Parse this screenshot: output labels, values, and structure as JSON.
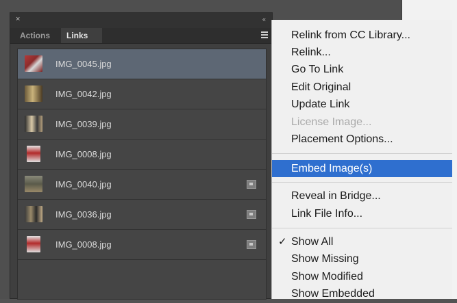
{
  "panel": {
    "close_glyph": "×",
    "collapse_glyph": "«",
    "tabs": [
      {
        "label": "Actions"
      },
      {
        "label": "Links"
      }
    ],
    "links": [
      {
        "name": "IMG_0045.jpg",
        "selected": true,
        "embedded": false
      },
      {
        "name": "IMG_0042.jpg",
        "selected": false,
        "embedded": false
      },
      {
        "name": "IMG_0039.jpg",
        "selected": false,
        "embedded": false
      },
      {
        "name": "IMG_0008.jpg",
        "selected": false,
        "embedded": false
      },
      {
        "name": "IMG_0040.jpg",
        "selected": false,
        "embedded": true
      },
      {
        "name": "IMG_0036.jpg",
        "selected": false,
        "embedded": true
      },
      {
        "name": "IMG_0008.jpg",
        "selected": false,
        "embedded": true
      }
    ]
  },
  "menu": {
    "check_glyph": "✓",
    "items": [
      {
        "label": "Relink from CC Library..."
      },
      {
        "label": "Relink..."
      },
      {
        "label": "Go To Link"
      },
      {
        "label": "Edit Original"
      },
      {
        "label": "Update Link"
      },
      {
        "label": "License Image...",
        "disabled": true
      },
      {
        "label": "Placement Options..."
      },
      {
        "label": "Embed Image(s)",
        "highlighted": true
      },
      {
        "label": "Reveal in Bridge..."
      },
      {
        "label": "Link File Info..."
      },
      {
        "label": "Show All",
        "checked": true
      },
      {
        "label": "Show Missing"
      },
      {
        "label": "Show Modified"
      },
      {
        "label": "Show Embedded"
      }
    ]
  },
  "colors": {
    "selection": "#5d6774",
    "menu_highlight": "#2f6fcf"
  }
}
